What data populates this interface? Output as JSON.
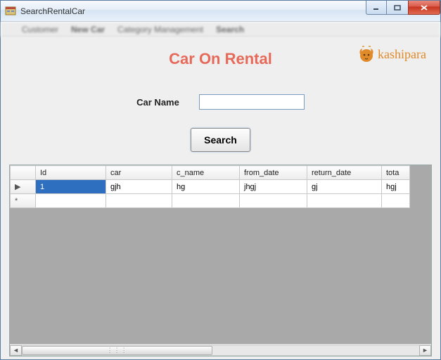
{
  "window": {
    "title": "SearchRentalCar"
  },
  "background_menu": [
    "Customer",
    "New Car",
    "Category Management",
    "Search"
  ],
  "header": {
    "title": "Car On Rental",
    "logo_text": "kashipara"
  },
  "form": {
    "car_name_label": "Car Name",
    "car_name_value": "",
    "search_button": "Search"
  },
  "grid": {
    "columns": [
      "Id",
      "car",
      "c_name",
      "from_date",
      "return_date",
      "tota"
    ],
    "rows": [
      {
        "Id": "1",
        "car": "gjh",
        "c_name": "hg",
        "from_date": "jhgj",
        "return_date": "gj",
        "tota": "hgj"
      }
    ],
    "row_marker_current": "▶",
    "row_marker_new": "*"
  }
}
